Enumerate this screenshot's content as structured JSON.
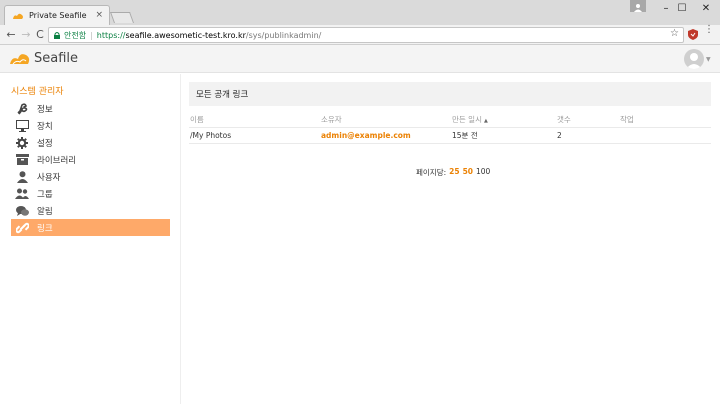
{
  "browser": {
    "tab_title": "Private Seafile",
    "tab_close": "×",
    "back": "←",
    "forward": "→",
    "reload": "C",
    "secure_label": "안전함",
    "url_protocol": "https://",
    "url_host": "seafile.awesometic-test.kro.kr",
    "url_path": "/sys/publinkadmin/",
    "bookmark_star": "☆",
    "menu": "⋮",
    "minimize": "–",
    "maximize": "☐",
    "close": "✕"
  },
  "app": {
    "logo_text": "Seafile",
    "caret": "▼"
  },
  "sidebar": {
    "title": "시스템 관리자",
    "items": [
      {
        "label": "정보",
        "icon": "wrench-icon"
      },
      {
        "label": "장치",
        "icon": "monitor-icon"
      },
      {
        "label": "설정",
        "icon": "gear-icon"
      },
      {
        "label": "라이브러리",
        "icon": "archive-icon"
      },
      {
        "label": "사용자",
        "icon": "user-icon"
      },
      {
        "label": "그룹",
        "icon": "group-icon"
      },
      {
        "label": "알림",
        "icon": "chat-icon"
      },
      {
        "label": "링크",
        "icon": "link-icon",
        "active": true
      }
    ]
  },
  "main": {
    "heading": "모든 공개 링크",
    "columns": [
      "이름",
      "소유자",
      "만든 일시",
      "갯수",
      "작업"
    ],
    "sort_indicator": "▲",
    "rows": [
      {
        "name": "/My Photos",
        "owner": "admin@example.com",
        "created": "15분 전",
        "count": "2",
        "action": ""
      }
    ],
    "pagination": {
      "label": "페이지당:",
      "options": [
        "25",
        "50",
        "100"
      ]
    }
  },
  "colors": {
    "accent": "#eb8205",
    "active_bg": "#fea969"
  }
}
